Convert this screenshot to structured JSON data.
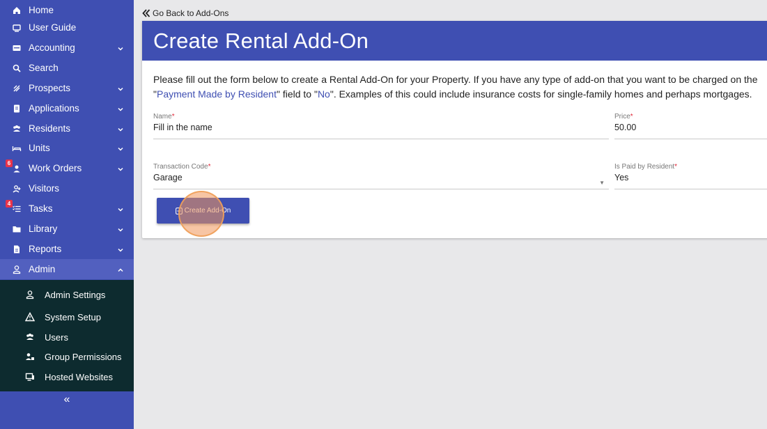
{
  "sidebar": {
    "items": [
      {
        "label": "Home",
        "icon": "home-icon",
        "chevron": false
      },
      {
        "label": "User Guide",
        "icon": "guide-icon",
        "chevron": false
      },
      {
        "label": "Accounting",
        "icon": "accounting-icon",
        "chevron": true
      },
      {
        "label": "Search",
        "icon": "search-icon",
        "chevron": false
      },
      {
        "label": "Prospects",
        "icon": "prospects-icon",
        "chevron": true
      },
      {
        "label": "Applications",
        "icon": "applications-icon",
        "chevron": true
      },
      {
        "label": "Residents",
        "icon": "residents-icon",
        "chevron": true
      },
      {
        "label": "Units",
        "icon": "bed-icon",
        "chevron": true
      },
      {
        "label": "Work Orders",
        "icon": "worker-icon",
        "chevron": true,
        "badge": "6"
      },
      {
        "label": "Visitors",
        "icon": "visitor-icon",
        "chevron": false
      },
      {
        "label": "Tasks",
        "icon": "tasks-icon",
        "chevron": true,
        "badge": "4"
      },
      {
        "label": "Library",
        "icon": "folder-icon",
        "chevron": true
      },
      {
        "label": "Reports",
        "icon": "report-icon",
        "chevron": true
      },
      {
        "label": "Admin",
        "icon": "admin-icon",
        "chevron": true,
        "active": true
      }
    ],
    "subitems": [
      {
        "label": "Admin Settings",
        "icon": "admin-settings-icon"
      },
      {
        "label": "System Setup",
        "icon": "warning-icon"
      },
      {
        "label": "Users",
        "icon": "users-icon"
      },
      {
        "label": "Group Permissions",
        "icon": "group-permissions-icon"
      },
      {
        "label": "Hosted Websites",
        "icon": "websites-icon"
      }
    ],
    "collapse_symbol": "«"
  },
  "back_link": "Go Back to Add-Ons",
  "page_title": "Create Rental Add-On",
  "description": {
    "line1": "Please fill out the form below to create a Rental Add-On for your Property. If you have any type of add-on that you want to be charged on the",
    "line2_pre": "\"",
    "line2_hl1": "Payment Made by Resident",
    "line2_mid": "\" field to \"",
    "line2_hl2": "No",
    "line2_post": "\". Examples of this could include insurance costs for single-family homes and perhaps mortgages."
  },
  "form": {
    "name": {
      "label": "Name",
      "value": "Fill in the name"
    },
    "price": {
      "label": "Price",
      "value": "50.00"
    },
    "transaction_code": {
      "label": "Transaction Code",
      "value": "Garage"
    },
    "is_paid": {
      "label": "Is Paid by Resident",
      "value": "Yes"
    },
    "required_mark": "*"
  },
  "submit_label": "Create Add-On",
  "colors": {
    "primary": "#3f4fb2",
    "submenu_bg": "#0d2b2f",
    "badge": "#e8334a"
  }
}
